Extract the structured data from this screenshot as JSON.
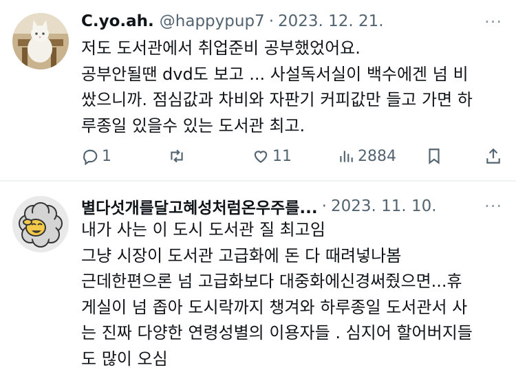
{
  "tweets": [
    {
      "name": "C.yo.ah.",
      "handle": "@happypup7",
      "separator": "·",
      "date": "2023. 12. 21.",
      "more": "···",
      "lines": [
        "저도 도서관에서 취업준비 공부했었어요.",
        "공부안될땐 dvd도 보고 ... 사설독서실이 백수에겐 넘 비",
        "쌌으니까. 점심값과 차비와 자판기 커피값만 들고 가면 하",
        "루종일 있을수 있는 도서관 최고."
      ],
      "actions": {
        "replies": "1",
        "retweets": "",
        "likes": "11",
        "views": "2884"
      }
    },
    {
      "name": "별다섯개를달고혜성처럼온우주를...",
      "handle": "",
      "separator": "·",
      "date": "2023. 11. 10.",
      "more": "···",
      "lines": [
        "내가 사는 이 도시 도서관 질 최고임",
        "그냥 시장이 도서관 고급화에 돈 다 때려넣나봄",
        "근데한편으론 넘 고급화보다 대중화에신경써줬으면...휴",
        "게실이 넘 좁아 도시락까지 챙겨와 하루종일 도서관서 사",
        "는 진짜 다양한 연령성별의 이용자들 . 심지어 할어버지들",
        "도 많이 오심"
      ]
    }
  ],
  "icons": {
    "reply": "reply-icon",
    "retweet": "retweet-icon",
    "like": "heart-icon",
    "views": "views-icon",
    "bookmark": "bookmark-icon",
    "share": "share-icon"
  },
  "colors": {
    "text": "#0f1419",
    "secondary": "#536471",
    "divider": "#eff3f4"
  }
}
